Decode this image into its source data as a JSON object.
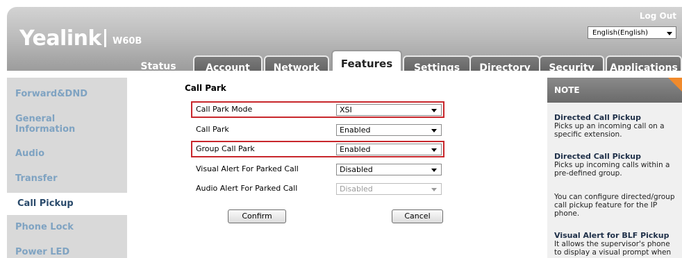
{
  "header": {
    "logo": "Yealink",
    "model": "W60B",
    "logout": "Log Out",
    "language": "English(English)"
  },
  "tabs": [
    "Status",
    "Account",
    "Network",
    "Features",
    "Settings",
    "Directory",
    "Security",
    "Applications"
  ],
  "active_tab": "Features",
  "sidebar": {
    "items": [
      "Forward&DND",
      "General Information",
      "Audio",
      "Transfer",
      "Call Pickup",
      "Phone Lock",
      "Power LED"
    ],
    "active": "Call Pickup"
  },
  "form": {
    "title": "Call Park",
    "rows": [
      {
        "label": "Call Park Mode",
        "value": "XSI",
        "disabled": false,
        "highlight": true
      },
      {
        "label": "Call Park",
        "value": "Enabled",
        "disabled": false,
        "highlight": false
      },
      {
        "label": "Group Call Park",
        "value": "Enabled",
        "disabled": false,
        "highlight": true
      },
      {
        "label": "Visual Alert For Parked Call",
        "value": "Disabled",
        "disabled": false,
        "highlight": false
      },
      {
        "label": "Audio Alert For Parked Call",
        "value": "Disabled",
        "disabled": true,
        "highlight": false
      }
    ],
    "confirm": "Confirm",
    "cancel": "Cancel"
  },
  "note": {
    "title": "NOTE",
    "blocks": [
      {
        "heading": "Directed Call Pickup",
        "text": "Picks up an incoming call on a specific extension."
      },
      {
        "heading": "Directed Call Pickup",
        "text": "Picks up incoming calls within a pre-defined group."
      },
      {
        "heading": "",
        "text": "You can configure directed/group call pickup feature for the IP phone."
      },
      {
        "heading": "Visual Alert for BLF Pickup",
        "text": "It allows the supervisor's phone to display a visual prompt when"
      }
    ]
  },
  "colors": {
    "highlight": "#c8272c",
    "note_accent": "#f08a2c",
    "sidebar_link": "#7fa3c2"
  }
}
